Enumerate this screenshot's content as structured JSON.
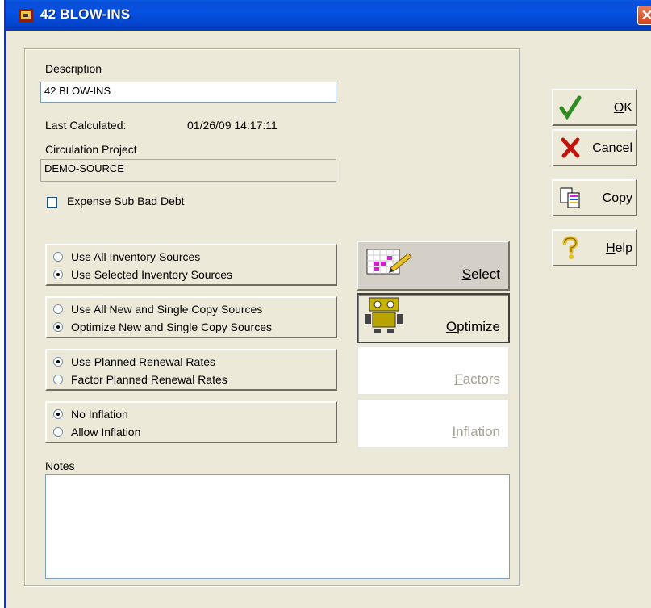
{
  "window": {
    "title": "42 BLOW-INS",
    "close_glyph": "✕"
  },
  "form": {
    "description_label": "Description",
    "description_value": "42 BLOW-INS",
    "last_calculated_label": "Last Calculated:",
    "last_calculated_value": "01/26/09 14:17:11",
    "circulation_project_label": "Circulation Project",
    "circulation_project_value": "DEMO-SOURCE",
    "expense_checkbox_label": "Expense Sub Bad Debt",
    "expense_checked": false,
    "notes_label": "Notes",
    "notes_value": ""
  },
  "option_groups": [
    {
      "options": [
        {
          "label": "Use All Inventory Sources",
          "selected": false
        },
        {
          "label": "Use Selected Inventory Sources",
          "selected": true
        }
      ]
    },
    {
      "options": [
        {
          "label": "Use All New and Single Copy Sources",
          "selected": false
        },
        {
          "label": "Optimize New and Single Copy Sources",
          "selected": true
        }
      ]
    },
    {
      "options": [
        {
          "label": "Use Planned Renewal Rates",
          "selected": true
        },
        {
          "label": "Factor Planned Renewal Rates",
          "selected": false
        }
      ]
    },
    {
      "options": [
        {
          "label": "No Inflation",
          "selected": true
        },
        {
          "label": "Allow Inflation",
          "selected": false
        }
      ]
    }
  ],
  "action_buttons": {
    "select": {
      "mnemonic": "S",
      "rest": "elect",
      "icon": "grid-pencil-icon"
    },
    "optimize": {
      "mnemonic": "O",
      "rest": "ptimize",
      "icon": "robot-icon"
    },
    "factors": {
      "mnemonic": "F",
      "rest": "actors"
    },
    "inflation": {
      "mnemonic": "I",
      "rest": "nflation"
    }
  },
  "side_buttons": {
    "ok": {
      "mnemonic": "O",
      "rest": "K",
      "icon": "checkmark-icon",
      "color": "#2e8b1f"
    },
    "cancel": {
      "mnemonic": "C",
      "rest": "ancel",
      "icon": "x-mark-icon",
      "color": "#c0140a"
    },
    "copy": {
      "mnemonic": "C",
      "rest": "opy",
      "icon": "copy-icon"
    },
    "help": {
      "mnemonic": "H",
      "rest": "elp",
      "icon": "question-icon"
    }
  }
}
